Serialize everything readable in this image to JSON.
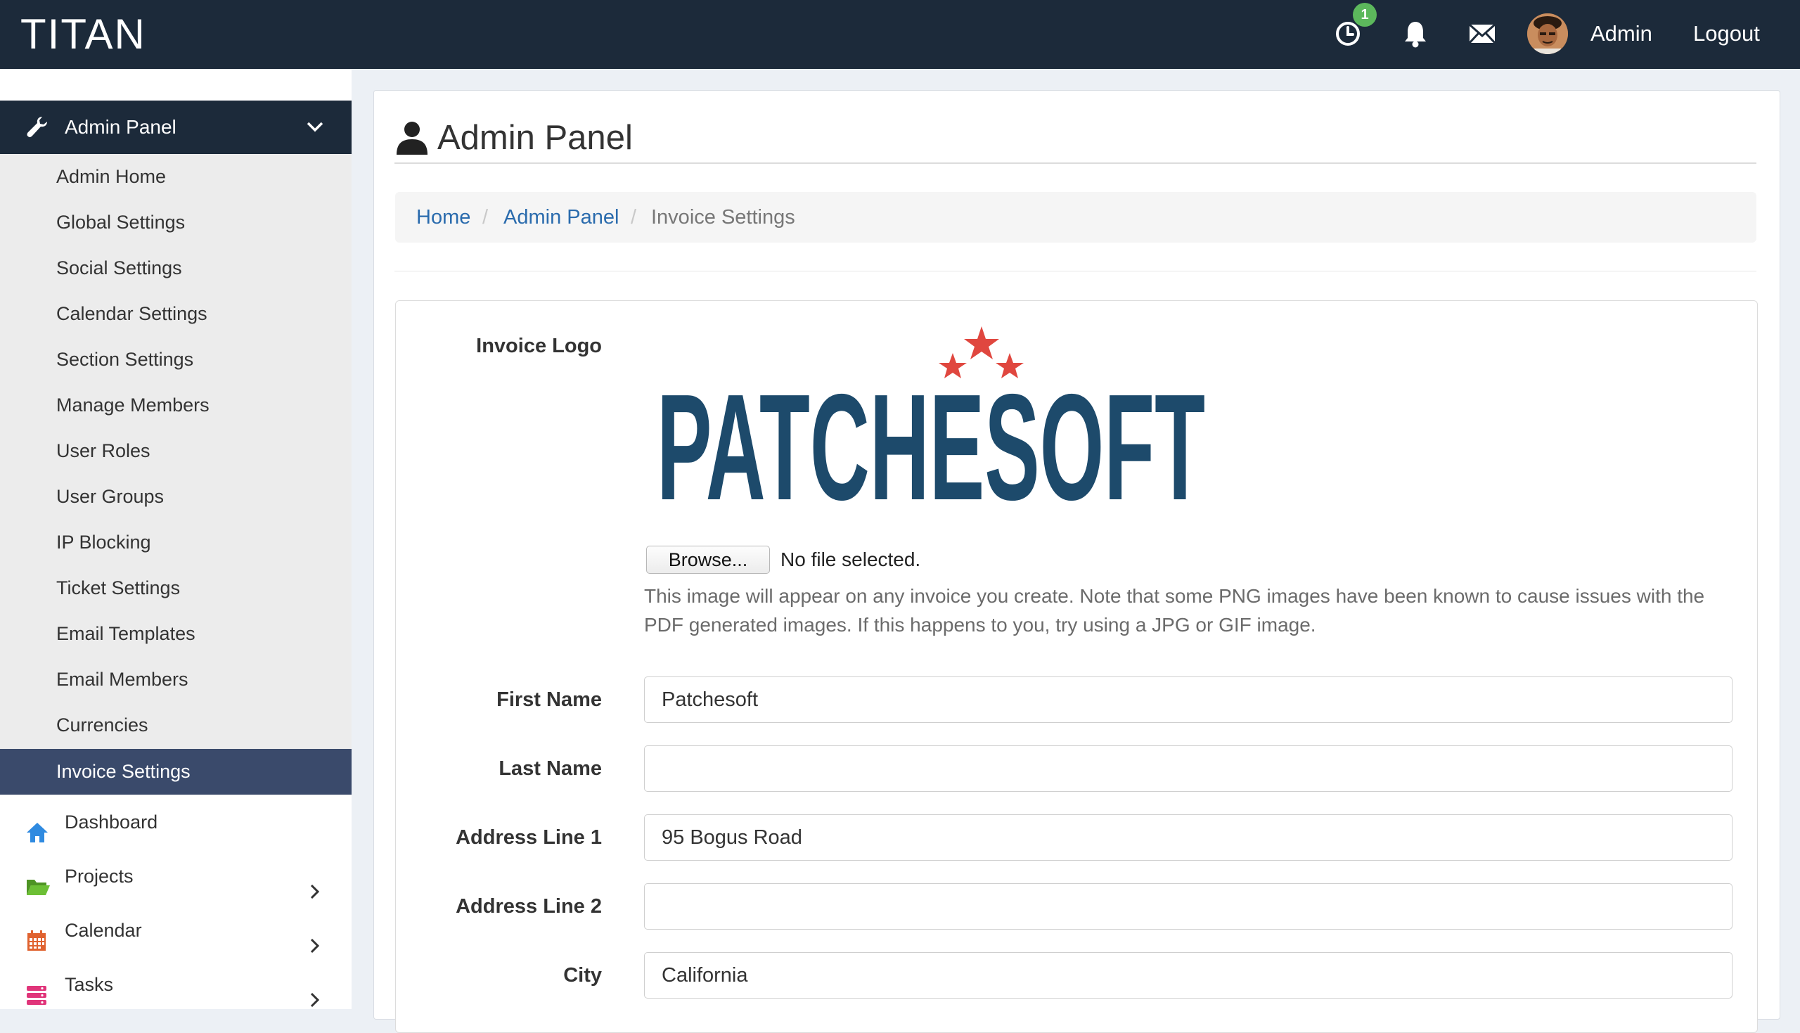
{
  "app": {
    "brand": "TITAN"
  },
  "topbar": {
    "badge_count": "1",
    "user_label": "Admin",
    "logout_label": "Logout"
  },
  "sidebar": {
    "section_label": "Admin Panel",
    "subitems": [
      "Admin Home",
      "Global Settings",
      "Social Settings",
      "Calendar Settings",
      "Section Settings",
      "Manage Members",
      "User Roles",
      "User Groups",
      "IP Blocking",
      "Ticket Settings",
      "Email Templates",
      "Email Members",
      "Currencies",
      "Invoice Settings"
    ],
    "active_subitem": "Invoice Settings",
    "nav": [
      {
        "label": "Dashboard",
        "icon": "home-icon",
        "color": "#2f8ae0"
      },
      {
        "label": "Projects",
        "icon": "folder-icon",
        "color": "#5aa62b"
      },
      {
        "label": "Calendar",
        "icon": "calendar-icon",
        "color": "#e0622f"
      },
      {
        "label": "Tasks",
        "icon": "tasks-icon",
        "color": "#e0357a"
      }
    ]
  },
  "page": {
    "title": "Admin Panel",
    "breadcrumb": [
      "Home",
      "Admin Panel",
      "Invoice Settings"
    ]
  },
  "form": {
    "logo_label": "Invoice Logo",
    "logo_text": "PATCHESOFT",
    "browse_label": "Browse...",
    "no_file_text": "No file selected.",
    "help_text": "This image will appear on any invoice you create. Note that some PNG images have been known to cause issues with the PDF generated images. If this happens to you, try using a JPG or GIF image.",
    "first_name_label": "First Name",
    "first_name_value": "Patchesoft",
    "last_name_label": "Last Name",
    "last_name_value": "",
    "address1_label": "Address Line 1",
    "address1_value": "95 Bogus Road",
    "address2_label": "Address Line 2",
    "address2_value": "",
    "city_label": "City",
    "city_value": "California"
  },
  "colors": {
    "topbar": "#1c2a3a",
    "active_item": "#3a4a6b",
    "link": "#2a6bad",
    "badge": "#5cb85c",
    "logo_blue": "#1d4a6b",
    "logo_star": "#e0473f"
  }
}
